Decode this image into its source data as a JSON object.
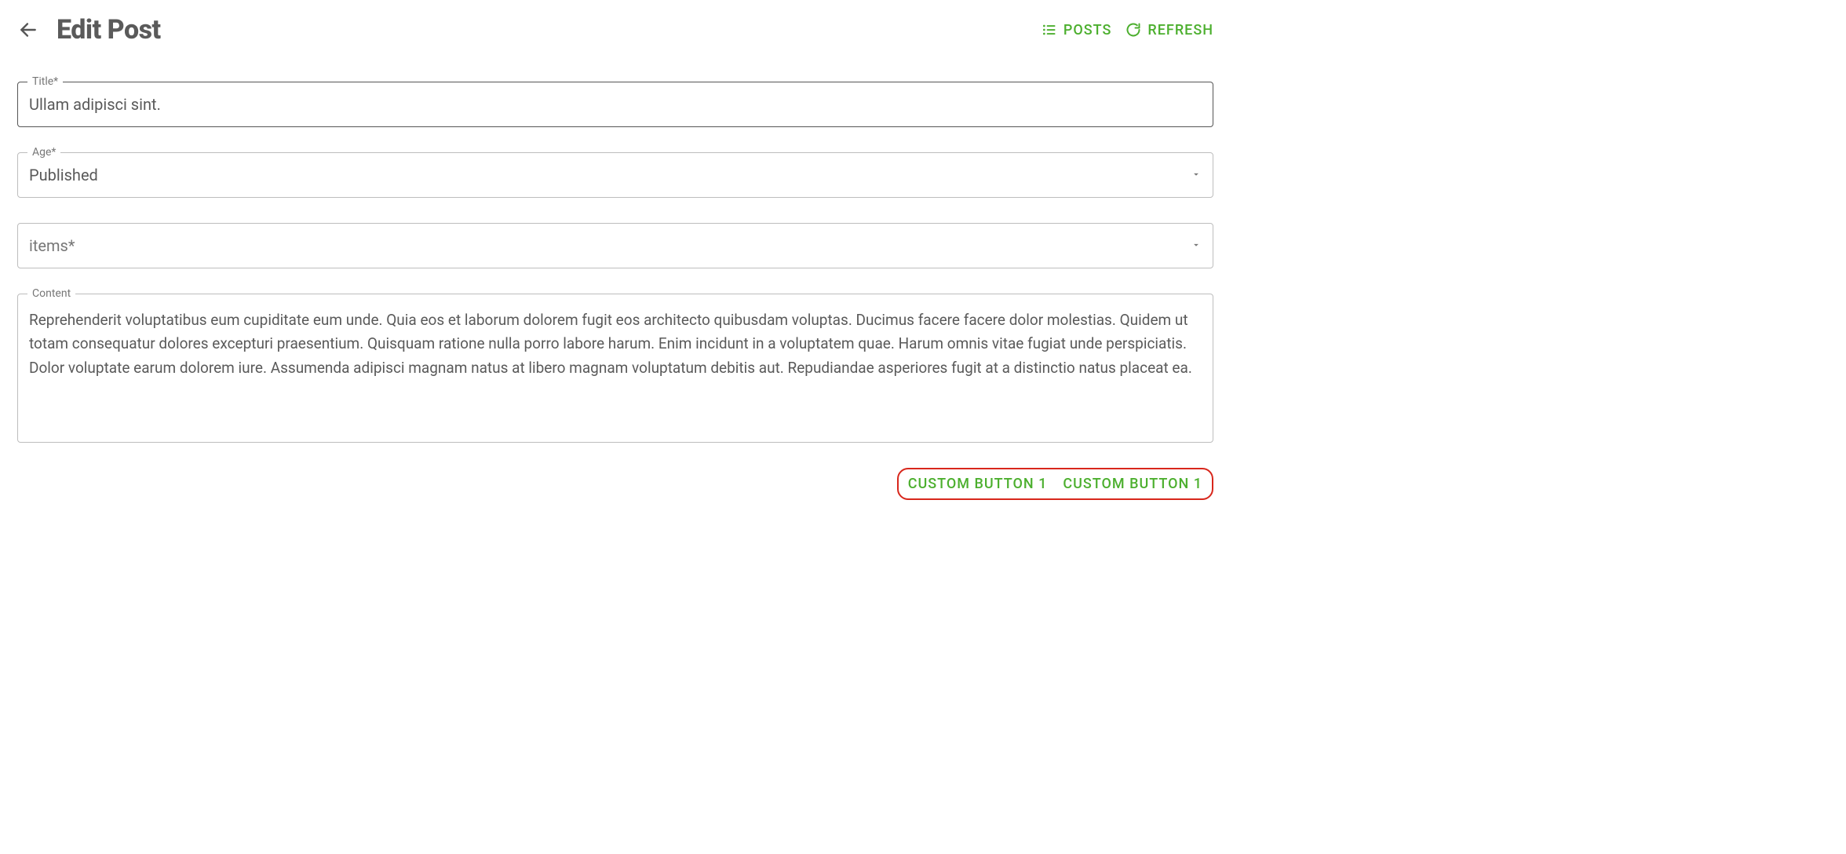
{
  "header": {
    "title": "Edit Post",
    "posts_label": "POSTS",
    "refresh_label": "REFRESH"
  },
  "form": {
    "title": {
      "label": "Title*",
      "value": "Ullam adipisci sint."
    },
    "age": {
      "label": "Age*",
      "value": "Published"
    },
    "items": {
      "placeholder": "items*"
    },
    "content": {
      "label": "Content",
      "value": "Reprehenderit voluptatibus eum cupiditate eum unde. Quia eos et laborum dolorem fugit eos architecto quibusdam voluptas. Ducimus facere facere dolor molestias. Quidem ut totam consequatur dolores excepturi praesentium. Quisquam ratione nulla porro labore harum. Enim incidunt in a voluptatem quae. Harum omnis vitae fugiat unde perspiciatis. Dolor voluptate earum dolorem iure. Assumenda adipisci magnam natus at libero magnam voluptatum debitis aut. Repudiandae asperiores fugit at a distinctio natus placeat ea."
    }
  },
  "footer": {
    "custom_button_1": "CUSTOM BUTTON 1",
    "custom_button_2": "CUSTOM BUTTON 1"
  },
  "colors": {
    "accent": "#4caf2e",
    "highlight_border": "#d8271c"
  }
}
